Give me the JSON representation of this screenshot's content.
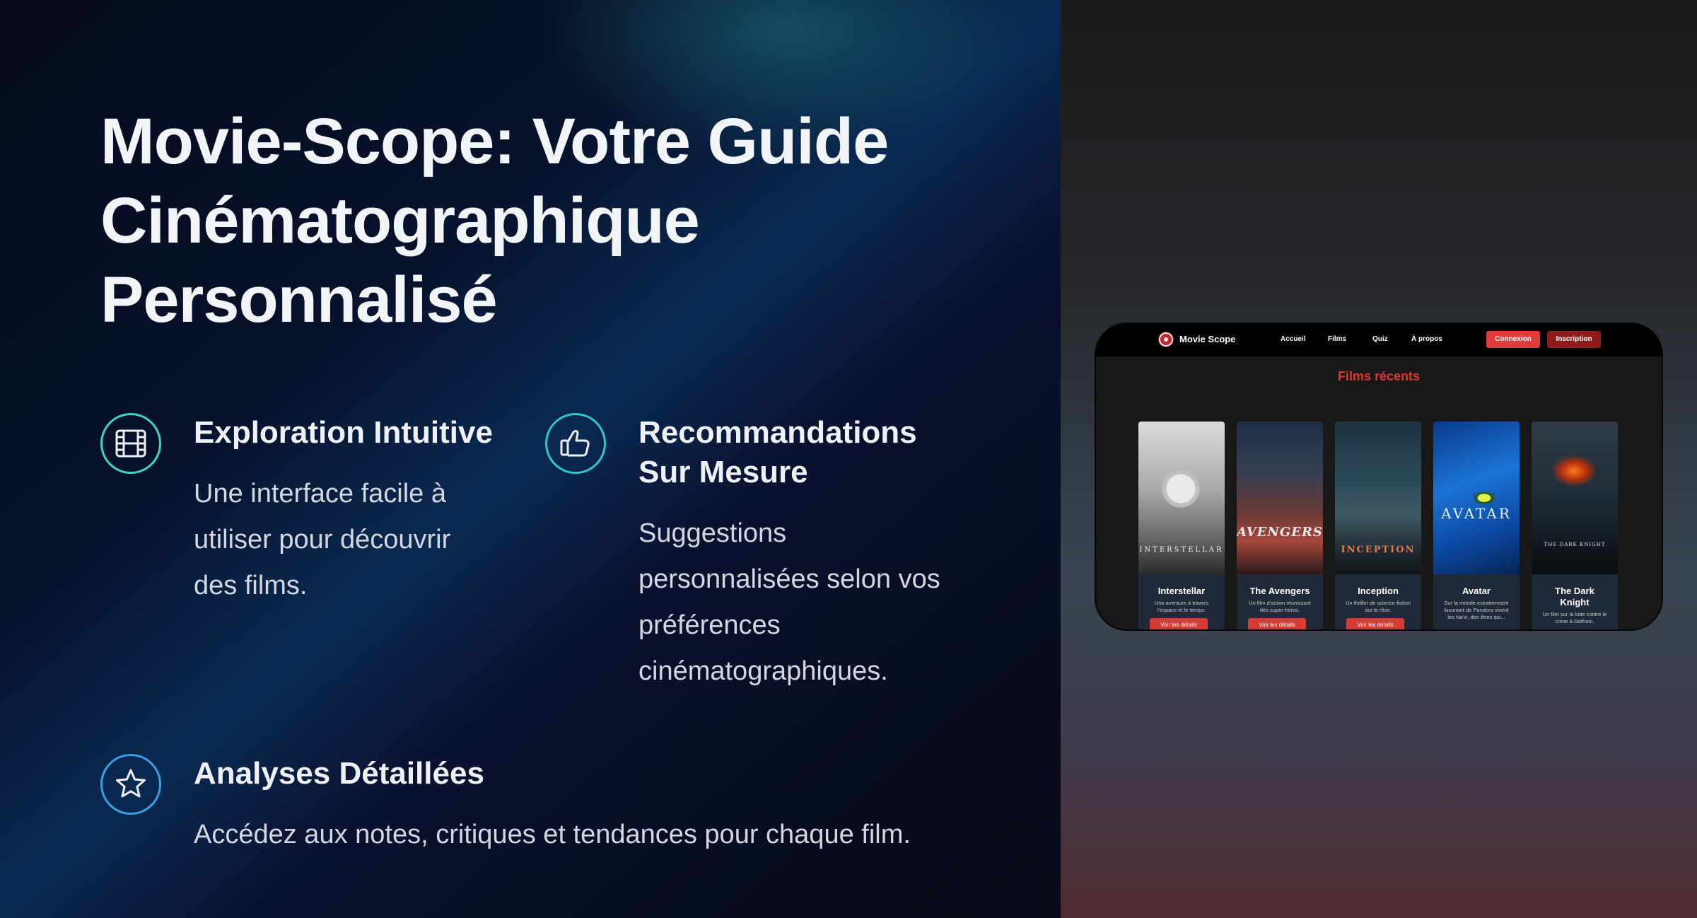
{
  "hero": {
    "title_lines": [
      "Movie-Scope: Votre Guide",
      "Cinématographique",
      "Personnalisé"
    ]
  },
  "features": [
    {
      "icon": "film-icon",
      "title": "Exploration Intuitive",
      "description_lines": [
        "Une interface facile à",
        "utiliser pour découvrir",
        "des films."
      ]
    },
    {
      "icon": "thumbs-up-icon",
      "title_lines": [
        "Recommandations",
        "Sur Mesure"
      ],
      "description_lines": [
        "Suggestions",
        "personnalisées selon vos",
        "préférences",
        "cinématographiques."
      ]
    },
    {
      "icon": "star-icon",
      "title": "Analyses Détaillées",
      "description": "Accédez aux notes, critiques et tendances pour chaque film."
    }
  ],
  "mockup": {
    "brand": "Movie Scope",
    "nav_links": [
      "Accueil",
      "Films",
      "Quiz",
      "À propos"
    ],
    "login_button": "Connexion",
    "signup_button": "Inscription",
    "section_heading": "Films récents",
    "movies": [
      {
        "title": "Interstellar",
        "poster_text": "INTERSTELLAR",
        "description_lines": [
          "Une aventure à travers",
          "l'espace et le temps."
        ],
        "button": "Voir les détails"
      },
      {
        "title": "The Avengers",
        "poster_text": "AVENGERS",
        "description_lines": [
          "Un film d'action réunissant",
          "des super-héros."
        ],
        "button": "Voir les détails"
      },
      {
        "title": "Inception",
        "poster_text": "INCEPTION",
        "description_lines": [
          "Un thriller de science-fiction",
          "sur le rêve."
        ],
        "button": "Voir les détails"
      },
      {
        "title": "Avatar",
        "poster_text": "AVATAR",
        "description_lines": [
          "Sur la monde extraterrestre",
          "luxuriant de Pandora vivent",
          "les Na'vi, des êtres qui..."
        ],
        "button": ""
      },
      {
        "title_lines": [
          "The Dark",
          "Knight"
        ],
        "poster_text": "THE DARK KNIGHT",
        "description_lines": [
          "Un film sur la lutte contre le",
          "crime à Gotham."
        ],
        "button": ""
      }
    ]
  },
  "colors": {
    "accent_teal": "#3fd4c4",
    "accent_blue": "#3aa0e6",
    "mock_red": "#d63a34"
  }
}
